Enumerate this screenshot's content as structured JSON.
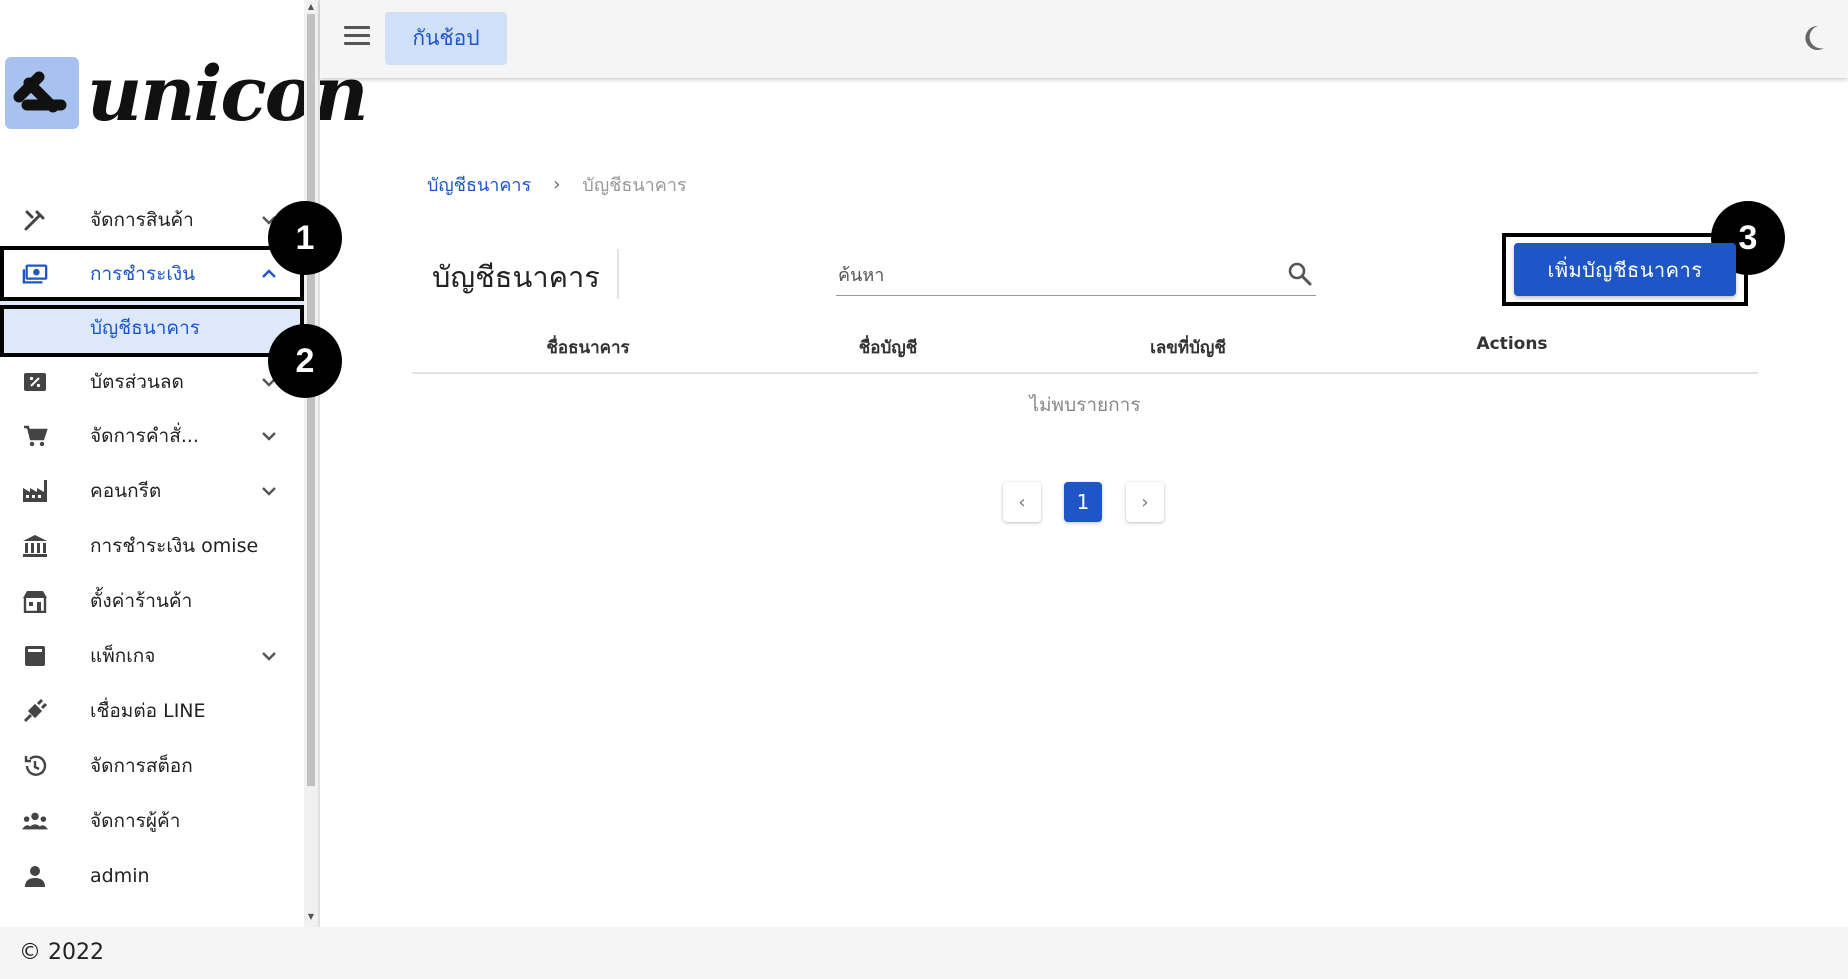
{
  "topbar": {
    "shop_label": "กันช้อป"
  },
  "logo": {
    "text": "unicon"
  },
  "sidebar": {
    "items": [
      {
        "label": "จัดการสินค้า",
        "icon": "tools-icon",
        "chevron": "down"
      },
      {
        "label": "การชำระเงิน",
        "icon": "payments-icon",
        "chevron": "up",
        "active": true
      },
      {
        "label": "บัญชีธนาคาร",
        "sub": true
      },
      {
        "label": "บัตรส่วนลด",
        "icon": "discount-icon",
        "chevron": "down"
      },
      {
        "label": "จัดการคำสั่...",
        "icon": "cart-icon",
        "chevron": "down"
      },
      {
        "label": "คอนกรีต",
        "icon": "factory-icon",
        "chevron": "down"
      },
      {
        "label": "การชำระเงิน omise",
        "icon": "bank-icon"
      },
      {
        "label": "ตั้งค่าร้านค้า",
        "icon": "store-icon"
      },
      {
        "label": "แพ็กเกจ",
        "icon": "package-icon",
        "chevron": "down"
      },
      {
        "label": "เชื่อมต่อ LINE",
        "icon": "plug-icon"
      },
      {
        "label": "จัดการสต็อก",
        "icon": "history-icon"
      },
      {
        "label": "จัดการผู้ค้า",
        "icon": "people-icon"
      },
      {
        "label": "admin",
        "icon": "person-icon"
      }
    ]
  },
  "annotations": [
    "1",
    "2",
    "3"
  ],
  "breadcrumb": {
    "link": "บัญชีธนาคาร",
    "separator": "›",
    "current": "บัญชีธนาคาร"
  },
  "page": {
    "title": "บัญชีธนาคาร",
    "search_placeholder": "ค้นหา",
    "add_button": "เพิ่มบัญชีธนาคาร"
  },
  "table": {
    "columns": [
      "ชื่อธนาคาร",
      "ชื่อบัญชี",
      "เลขที่บัญชี",
      "Actions"
    ],
    "empty_text": "ไม่พบรายการ"
  },
  "pagination": {
    "prev": "‹",
    "current_page": "1",
    "next": "›"
  },
  "footer": {
    "copyright": "© 2022"
  },
  "colors": {
    "accent": "#1e56c8",
    "accent_light": "#dde9fb",
    "chip_bg": "#cfe0f7",
    "logo_badge": "#a8c2f0"
  }
}
